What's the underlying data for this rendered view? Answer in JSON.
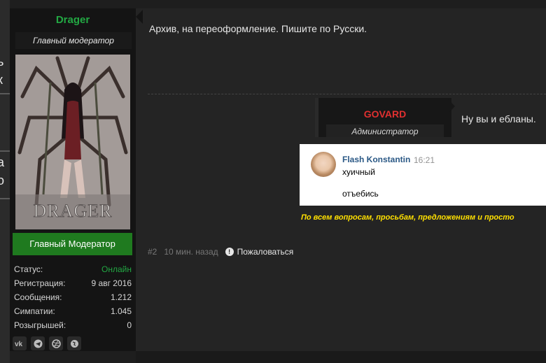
{
  "edge_fragments": [
    "ь",
    "к",
    "а",
    "о"
  ],
  "author": {
    "name": "Drager",
    "title": "Главный модератор",
    "avatar_caption": "DRAGER",
    "role_button": "Главный Модератор",
    "name_color": "#22a843"
  },
  "stats": [
    {
      "label": "Статус:",
      "value": "Онлайн"
    },
    {
      "label": "Регистрация:",
      "value": "9 авг 2016"
    },
    {
      "label": "Сообщения:",
      "value": "1.212"
    },
    {
      "label": "Симпатии:",
      "value": "1.045"
    },
    {
      "label": "Розыгрышей:",
      "value": "0"
    }
  ],
  "socials": [
    "vk-icon",
    "telegram-icon",
    "dribbble-icon",
    "globe-icon"
  ],
  "post": {
    "message": "Архив, на переоформление. Пишите по Русски.",
    "quote": {
      "name": "GOVARD",
      "title": "Администратор",
      "message": "Ну вы и ебланы.",
      "name_color": "#e03030"
    },
    "chat": {
      "name": "Flash Konstantin",
      "time": "16:21",
      "line1": "хуичный",
      "line2": "отъебись"
    },
    "signature": "По всем вопросам, просьбам, предложениям и просто",
    "number": "#2",
    "time_ago": "10 мин. назад",
    "report": "Пожаловаться"
  }
}
